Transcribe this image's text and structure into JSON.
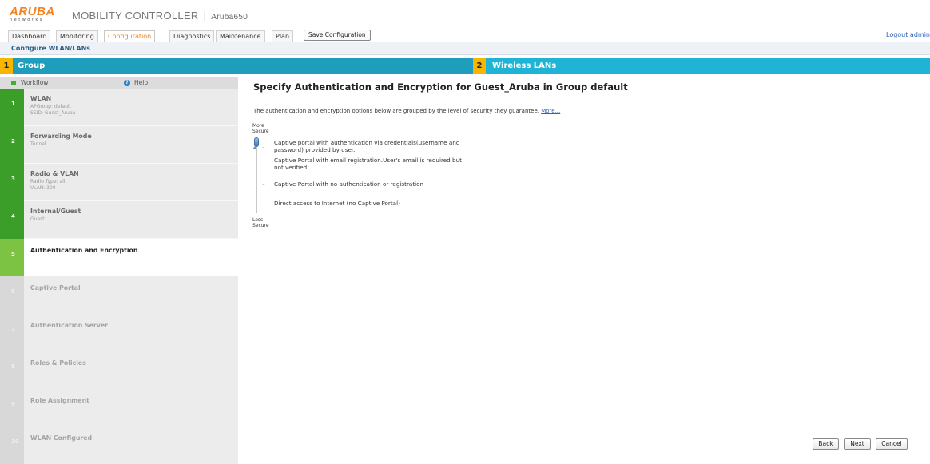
{
  "header": {
    "logo_brand": "ARUBA",
    "logo_sub": "networks",
    "product": "MOBILITY CONTROLLER",
    "separator": "|",
    "host": "Aruba650"
  },
  "menu": {
    "tabs": [
      {
        "label": "Dashboard",
        "active": false
      },
      {
        "label": "Monitoring",
        "active": false
      },
      {
        "label": "Configuration",
        "active": true
      },
      {
        "label": "Diagnostics",
        "active": false
      },
      {
        "label": "Maintenance",
        "active": false
      },
      {
        "label": "Plan",
        "active": false
      }
    ],
    "save_button": "Save Configuration",
    "logout": "Logout admin"
  },
  "page": {
    "title": "Configure WLAN/LANs"
  },
  "steps": [
    {
      "number": "1",
      "label": "Group"
    },
    {
      "number": "2",
      "label": "Wireless LANs"
    }
  ],
  "sidebar": {
    "workflow_label": "Workflow",
    "help_label": "Help",
    "items": [
      {
        "number": "1",
        "title": "WLAN",
        "sub": [
          "APGroup: default",
          "SSID: Guest_Aruba"
        ],
        "state": "done"
      },
      {
        "number": "2",
        "title": "Forwarding Mode",
        "sub": [
          "Tunnel"
        ],
        "state": "done"
      },
      {
        "number": "3",
        "title": "Radio & VLAN",
        "sub": [
          "Radio Type: all",
          "VLAN: 300"
        ],
        "state": "done"
      },
      {
        "number": "4",
        "title": "Internal/Guest",
        "sub": [
          "Guest"
        ],
        "state": "done"
      },
      {
        "number": "5",
        "title": "Authentication and Encryption",
        "sub": [],
        "state": "current"
      },
      {
        "number": "6",
        "title": "Captive Portal",
        "sub": [],
        "state": "todo"
      },
      {
        "number": "7",
        "title": "Authentication Server",
        "sub": [],
        "state": "todo"
      },
      {
        "number": "8",
        "title": "Roles & Policies",
        "sub": [],
        "state": "todo"
      },
      {
        "number": "9",
        "title": "Role Assignment",
        "sub": [],
        "state": "todo"
      },
      {
        "number": "10",
        "title": "WLAN Configured",
        "sub": [],
        "state": "todo"
      }
    ]
  },
  "main": {
    "title": "Specify Authentication and Encryption for Guest_Aruba in Group default",
    "intro": "The authentication and encryption options below are grouped by the level of security they guarantee.",
    "more_link": "More...",
    "scale_top": [
      "More",
      "Secure"
    ],
    "scale_bottom": [
      "Less",
      "Secure"
    ],
    "options": [
      {
        "label": [
          "Captive portal with authentication via credentials(username and",
          "password) provided by user."
        ],
        "selected": true
      },
      {
        "label": [
          "Captive Portal with email registration.User's email is required but",
          "not verified"
        ],
        "selected": false
      },
      {
        "label": [
          "Captive Portal with no authentication or registration"
        ],
        "selected": false
      },
      {
        "label": [
          "Direct access to Internet (no Captive Portal)"
        ],
        "selected": false
      }
    ],
    "buttons": {
      "back": "Back",
      "next": "Next",
      "cancel": "Cancel"
    }
  },
  "colors": {
    "accent_orange": "#f58220",
    "step_blue": "#1f9dbd",
    "step_blue_light": "#1fb4d6",
    "step_number": "#f7b500",
    "done_green": "#3a9e29",
    "current_green": "#7cc243",
    "link_blue": "#2a62b5"
  }
}
